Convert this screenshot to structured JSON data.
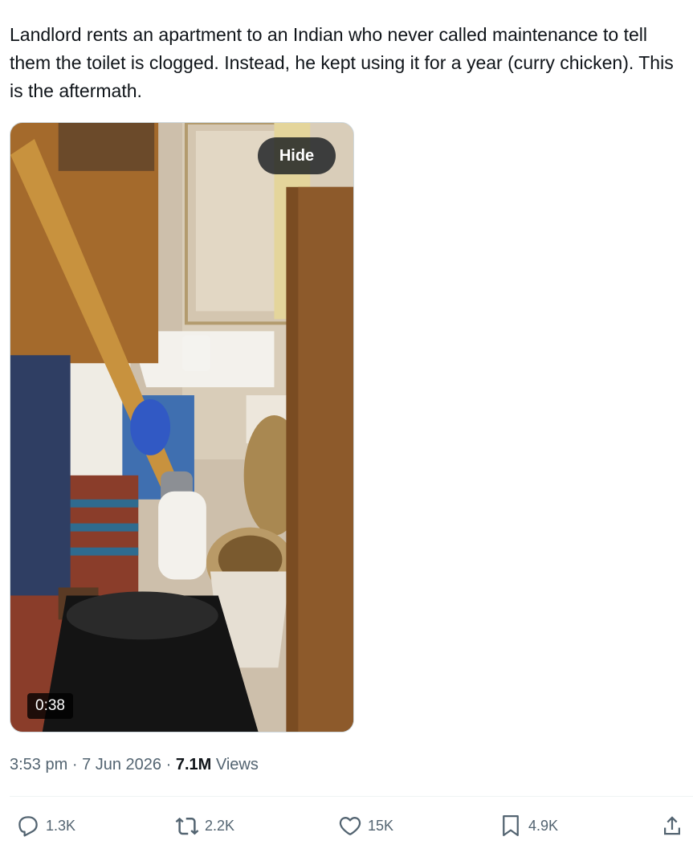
{
  "tweet": {
    "text": "Landlord rents an apartment to an Indian who never called maintenance to tell them the toilet is clogged. Instead, he kept using it for a year (curry chicken). This is the aftermath."
  },
  "media": {
    "hide_label": "Hide",
    "duration": "0:38"
  },
  "meta": {
    "time": "3:53 pm",
    "separator": "·",
    "date": "7 Jun 2026",
    "views_count": "7.1M",
    "views_label": "Views"
  },
  "actions": {
    "reply": {
      "icon": "reply-icon",
      "count": "1.3K"
    },
    "retweet": {
      "icon": "retweet-icon",
      "count": "2.2K"
    },
    "like": {
      "icon": "heart-icon",
      "count": "15K"
    },
    "bookmark": {
      "icon": "bookmark-icon",
      "count": "4.9K"
    },
    "share": {
      "icon": "share-icon"
    }
  },
  "colors": {
    "text": "#0f1419",
    "secondary": "#536471",
    "divider": "#eff3f4"
  }
}
